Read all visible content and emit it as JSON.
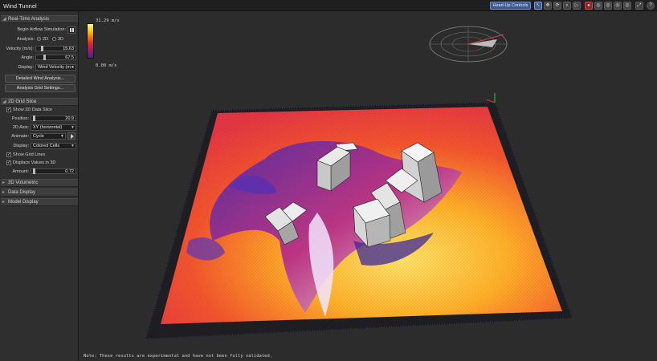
{
  "window": {
    "title": "Wind Tunnel"
  },
  "toolbar": {
    "hud_label": "Head-Up Controls",
    "icons": [
      "pointer-icon",
      "pan-icon",
      "orbit-icon",
      "zoom-icon",
      "play-icon",
      "record-icon",
      "view-icon",
      "view-icon",
      "view-icon",
      "view-icon",
      "fit-icon",
      "help-icon"
    ]
  },
  "realtime": {
    "header": "Real-Time Analysis",
    "begin_label": "Begin Airflow Simulation:",
    "analysis_label": "Analysis:",
    "opt_2d": "2D",
    "opt_3d": "3D",
    "velocity_label": "Velocity (m/s):",
    "velocity_value": "15.63",
    "velocity_fraction": 0.12,
    "angle_label": "Angle:",
    "angle_value": "67.5",
    "angle_fraction": 0.19,
    "display_label": "Display:",
    "display_value": "Wind Velocity (m...",
    "detailed_btn": "Detailed Wind Analysis...",
    "grid_settings_btn": "Analysis Grid Settings..."
  },
  "slice": {
    "header": "2D Grid Slice",
    "show_label": "Show 2D Data Slice",
    "position_label": "Position:",
    "position_value": "20.9",
    "position_fraction": 0.03,
    "axis_label": "2D Axis:",
    "axis_value": "XY (horizontal)",
    "animate_label": "Animate:",
    "animate_value": "Cycle",
    "display_label": "Display:",
    "display_value": "Colored Cells",
    "grid_lines_label": "Show Grid Lines",
    "displace_label": "Displace Values in 3D",
    "amount_label": "Amount:",
    "amount_value": "0.72",
    "amount_fraction": 0.03
  },
  "panels": {
    "volumetric": "3D Volumetric",
    "data_display": "Data Display",
    "model_display": "Model Display"
  },
  "legend": {
    "max_label": "31.29 m/s",
    "min_label": "0.00 m/s"
  },
  "footer": {
    "note": "Note: These results are experimental and have not been fully validated."
  },
  "colors": {
    "accent": "#3c5a8e",
    "panel": "#2f2f2f",
    "viewport": "#2c2c2c"
  }
}
